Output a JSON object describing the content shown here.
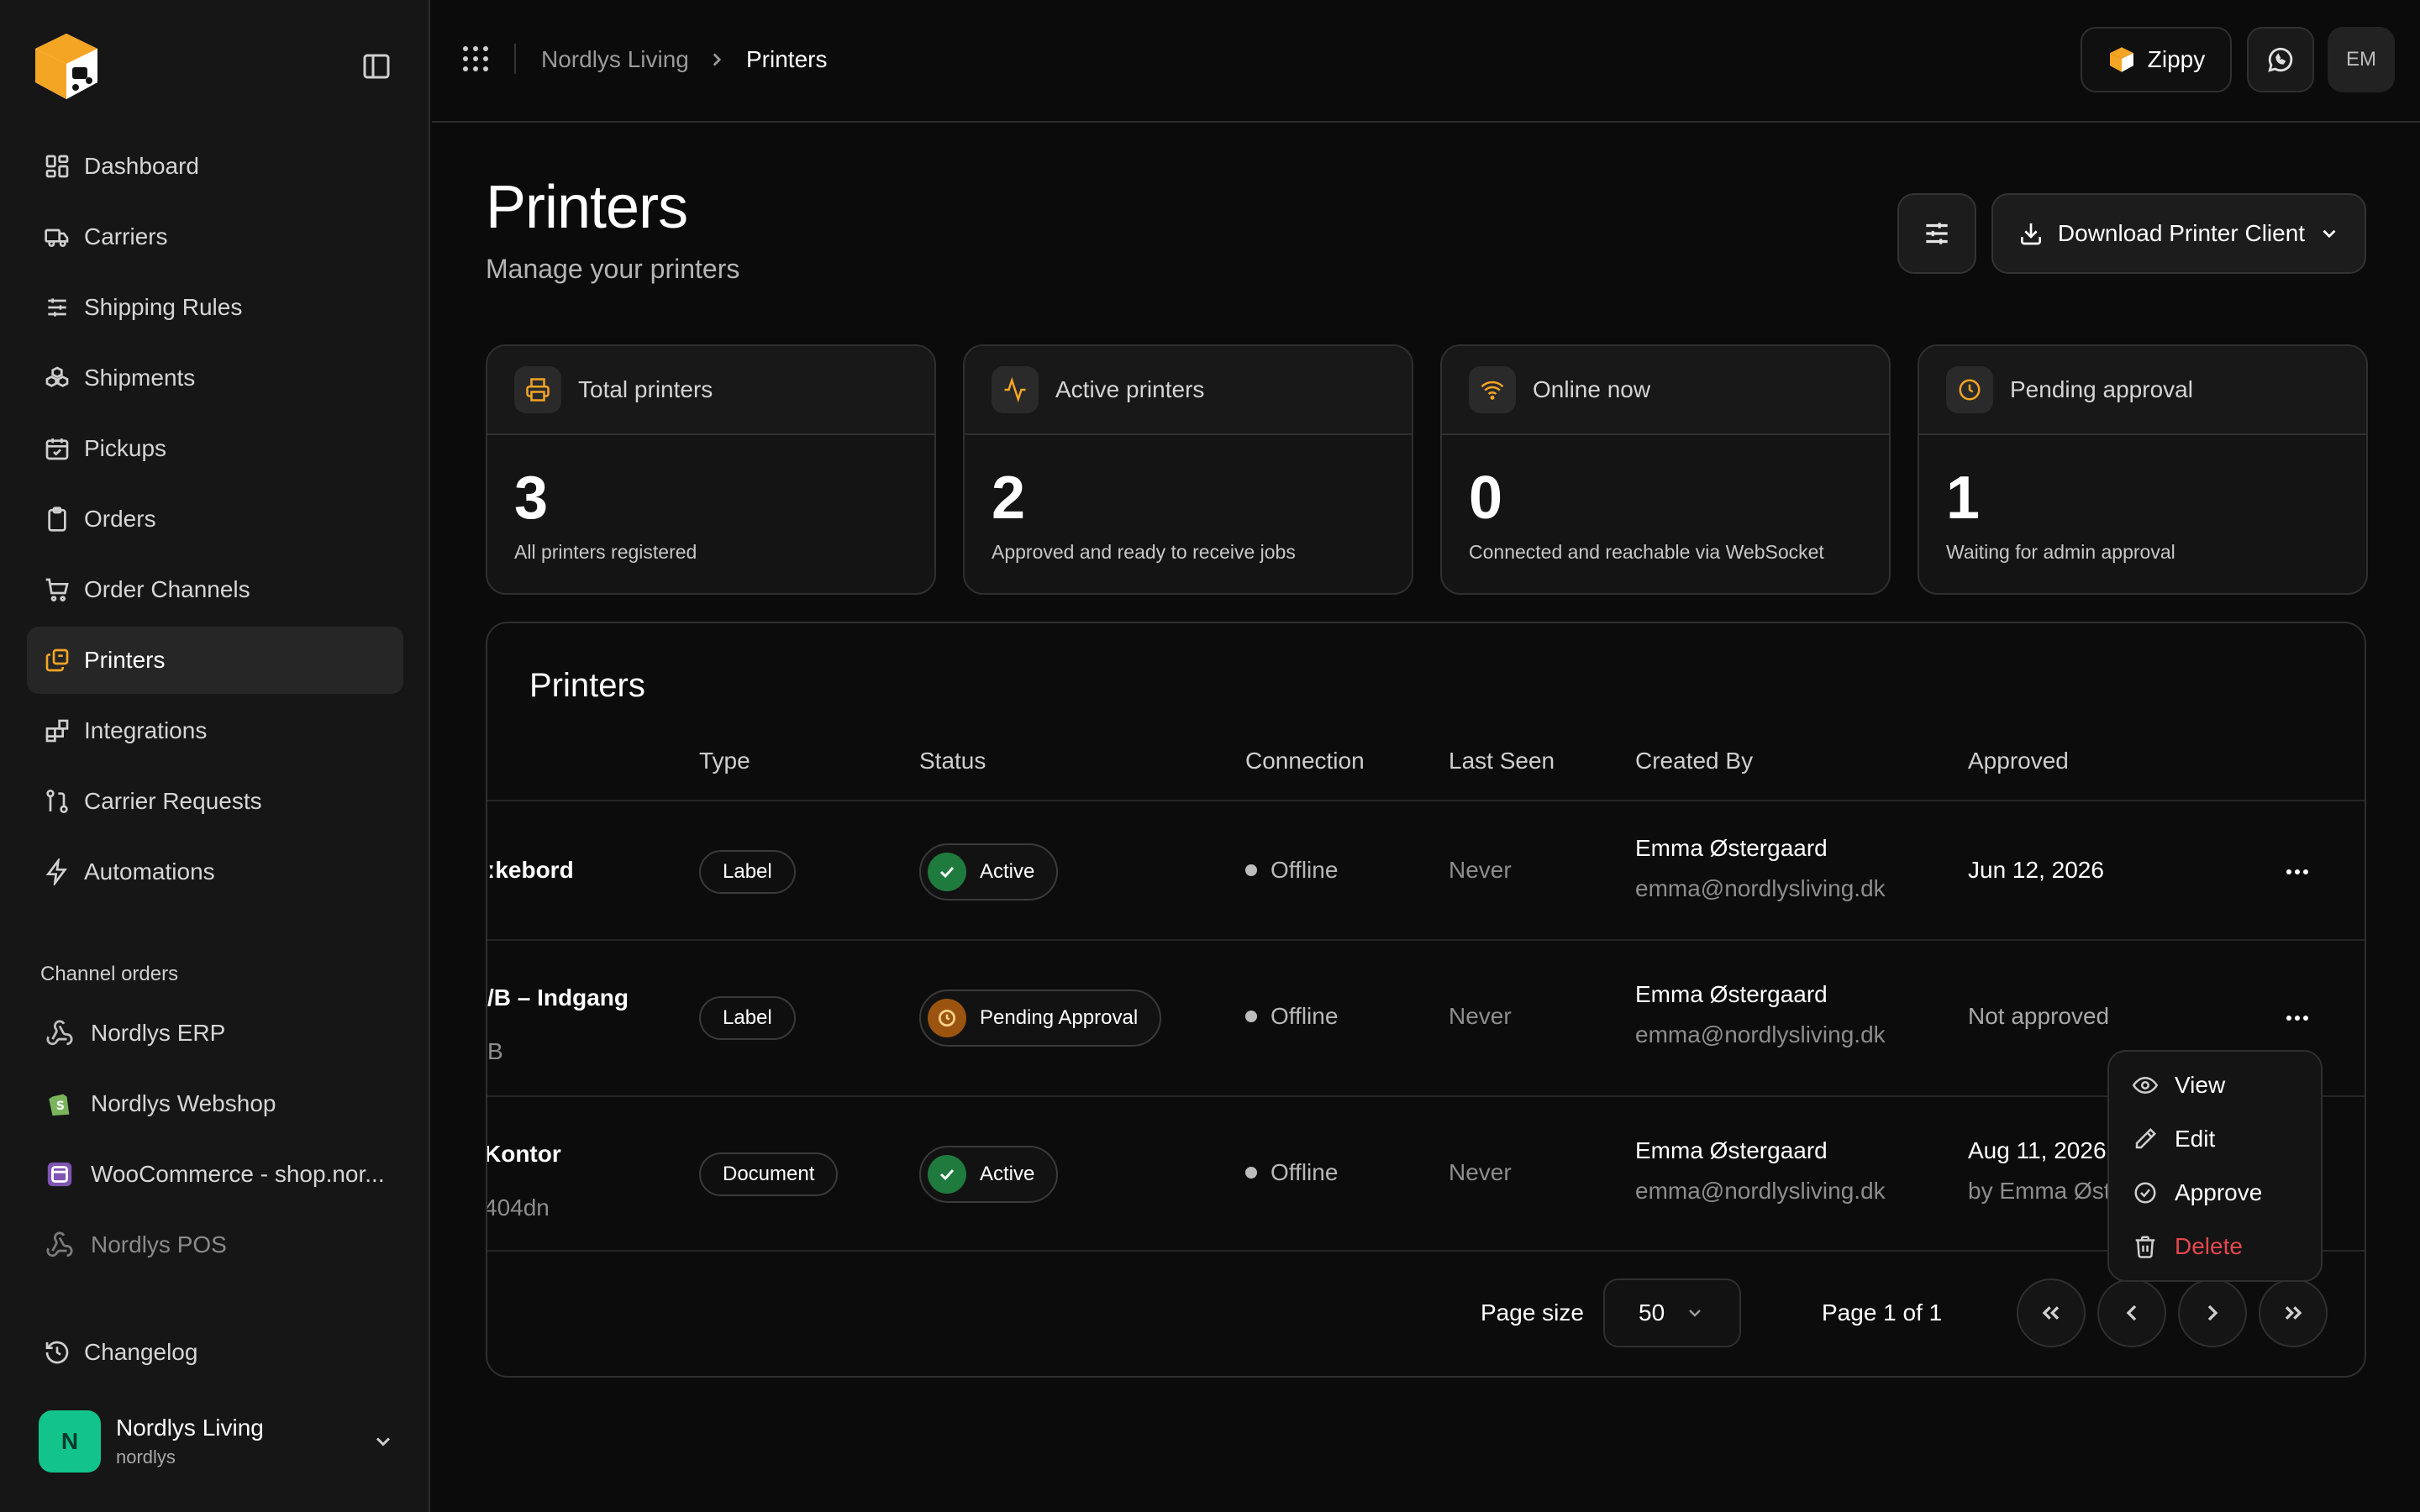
{
  "sidebar": {
    "nav": [
      {
        "label": "Dashboard",
        "icon": "dashboard-icon"
      },
      {
        "label": "Carriers",
        "icon": "truck-icon"
      },
      {
        "label": "Shipping Rules",
        "icon": "sliders-icon"
      },
      {
        "label": "Shipments",
        "icon": "boxes-icon"
      },
      {
        "label": "Pickups",
        "icon": "calendar-icon"
      },
      {
        "label": "Orders",
        "icon": "clipboard-icon"
      },
      {
        "label": "Order Channels",
        "icon": "cart-icon"
      },
      {
        "label": "Printers",
        "icon": "printers-icon",
        "active": true
      },
      {
        "label": "Integrations",
        "icon": "blocks-icon"
      },
      {
        "label": "Carrier Requests",
        "icon": "git-pull-icon"
      },
      {
        "label": "Automations",
        "icon": "zap-icon"
      }
    ],
    "channels_label": "Channel orders",
    "channels": [
      {
        "label": "Nordlys ERP",
        "icon": "webhook-icon"
      },
      {
        "label": "Nordlys Webshop",
        "icon": "shopify-icon"
      },
      {
        "label": "WooCommerce - shop.nor...",
        "icon": "woocommerce-icon"
      },
      {
        "label": "Nordlys POS",
        "icon": "webhook-icon",
        "dim": true
      }
    ],
    "changelog": "Changelog",
    "org": {
      "initial": "N",
      "name": "Nordlys Living",
      "slug": "nordlys"
    }
  },
  "topbar": {
    "breadcrumb": [
      "Nordlys Living",
      "Printers"
    ],
    "zippy_label": "Zippy",
    "user_initials": "EM"
  },
  "page": {
    "title": "Printers",
    "subtitle": "Manage your printers",
    "download_label": "Download Printer Client"
  },
  "stats": [
    {
      "label": "Total printers",
      "value": "3",
      "desc": "All printers registered",
      "icon": "printer-icon"
    },
    {
      "label": "Active printers",
      "value": "2",
      "desc": "Approved and ready to receive jobs",
      "icon": "activity-icon"
    },
    {
      "label": "Online now",
      "value": "0",
      "desc": "Connected and reachable via WebSocket",
      "icon": "wifi-icon"
    },
    {
      "label": "Pending approval",
      "value": "1",
      "desc": "Waiting for admin approval",
      "icon": "clock-icon"
    }
  ],
  "table": {
    "title": "Printers",
    "columns": [
      "Type",
      "Status",
      "Connection",
      "Last Seen",
      "Created By",
      "Approved"
    ],
    "rows": [
      {
        "name": "ːkebord",
        "sub": "",
        "type": "Label",
        "status": "Active",
        "connection": "Offline",
        "last_seen": "Never",
        "creator": "Emma Østergaard",
        "email": "emma@nordlysliving.dk",
        "approved": "Jun 12, 2026",
        "approved_by": ""
      },
      {
        "name": "/B – Indgang",
        "sub": "B",
        "type": "Label",
        "status": "Pending Approval",
        "connection": "Offline",
        "last_seen": "Never",
        "creator": "Emma Østergaard",
        "email": "emma@nordlysliving.dk",
        "approved": "Not approved",
        "approved_by": ""
      },
      {
        "name": "Kontor",
        "sub": "404dn",
        "type": "Document",
        "status": "Active",
        "connection": "Offline",
        "last_seen": "Never",
        "creator": "Emma Østergaard",
        "email": "emma@nordlysliving.dk",
        "approved": "Aug 11, 2026",
        "approved_by": "by Emma Øst"
      }
    ],
    "pagination": {
      "page_size_label": "Page size",
      "page_size": "50",
      "page_info": "Page 1 of 1"
    }
  },
  "context_menu": {
    "items": [
      {
        "label": "View",
        "icon": "eye-icon"
      },
      {
        "label": "Edit",
        "icon": "pencil-icon"
      },
      {
        "label": "Approve",
        "icon": "check-circle-icon"
      },
      {
        "label": "Delete",
        "icon": "trash-icon",
        "danger": true
      }
    ]
  },
  "colors": {
    "accent": "#f5a524",
    "active_green": "#1f7a3e",
    "pending_orange": "#9a5410",
    "danger": "#e5484d",
    "org_green": "#12c48b"
  }
}
